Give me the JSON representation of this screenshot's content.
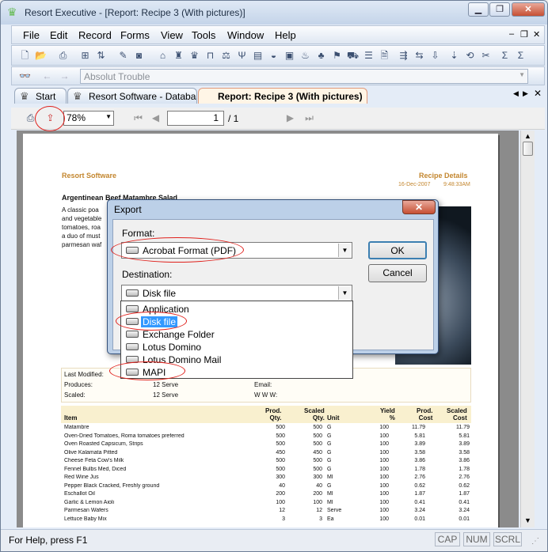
{
  "window": {
    "title": "Resort Executive - [Report: Recipe  3 (With pictures)]",
    "controls": {
      "minimize": "▁",
      "restore": "❐",
      "close": "✕"
    },
    "mdi_controls": {
      "minimize": "–",
      "restore": "❐",
      "close": "✕"
    }
  },
  "menu": [
    "File",
    "Edit",
    "Record",
    "Forms",
    "View",
    "Tools",
    "Window",
    "Help"
  ],
  "search": {
    "value": "Absolut Trouble"
  },
  "tabs": [
    {
      "label": "Start"
    },
    {
      "label": "Resort Software - Database"
    },
    {
      "label": "Report: Recipe  3 (With pictures)"
    }
  ],
  "viewer": {
    "zoom": "78%",
    "page": "1",
    "page_total": "/ 1"
  },
  "report": {
    "company": "Resort Software",
    "heading": "Recipe Details",
    "date": "16-Dec-2007",
    "time": "9:48:33AM",
    "recipe_name": "Argentinean Beef Matambre Salad",
    "description": [
      "A classic poa",
      "and vegetable",
      "tomatoes, roa",
      "a duo of must",
      "parmesan waf"
    ],
    "info": {
      "last_modified_label": "Last Modified:",
      "produces_label": "Produces:",
      "produces_value": "12 Serve",
      "scaled_label": "Scaled:",
      "scaled_value": "12 Serve",
      "email_label": "Email:",
      "www_label": "W W W:"
    },
    "table_headers": {
      "item": "Item",
      "prod_qty": "Prod.\nQty.",
      "scaled_qty": "Scaled\nQty.",
      "unit": "Unit",
      "yield": "Yield\n%",
      "prod_cost": "Prod.\nCost",
      "scaled_cost": "Scaled\nCost"
    },
    "rows": [
      {
        "item": "Matambre",
        "prod": "500",
        "scaled": "500",
        "unit": "G",
        "yield": "100",
        "pcost": "11.79",
        "scost": "11.79"
      },
      {
        "item": "Oven-Dried Tomatoes, Roma tomatoes preferred",
        "prod": "500",
        "scaled": "500",
        "unit": "G",
        "yield": "100",
        "pcost": "5.81",
        "scost": "5.81"
      },
      {
        "item": "Oven Roasted Capsicum, Strips",
        "prod": "500",
        "scaled": "500",
        "unit": "G",
        "yield": "100",
        "pcost": "3.89",
        "scost": "3.89"
      },
      {
        "item": "Olive Kalamata Pitted",
        "prod": "450",
        "scaled": "450",
        "unit": "G",
        "yield": "100",
        "pcost": "3.58",
        "scost": "3.58"
      },
      {
        "item": "Cheese Feta Cow's Milk",
        "prod": "500",
        "scaled": "500",
        "unit": "G",
        "yield": "100",
        "pcost": "3.86",
        "scost": "3.86"
      },
      {
        "item": "Fennel Bulbs Med, Diced",
        "prod": "500",
        "scaled": "500",
        "unit": "G",
        "yield": "100",
        "pcost": "1.78",
        "scost": "1.78"
      },
      {
        "item": "Red Wine Jus",
        "prod": "300",
        "scaled": "300",
        "unit": "Ml",
        "yield": "100",
        "pcost": "2.76",
        "scost": "2.76"
      },
      {
        "item": "Pepper Black Cracked, Freshly ground",
        "prod": "40",
        "scaled": "40",
        "unit": "G",
        "yield": "100",
        "pcost": "0.62",
        "scost": "0.62"
      },
      {
        "item": "Eschallot Oil",
        "prod": "200",
        "scaled": "200",
        "unit": "Ml",
        "yield": "100",
        "pcost": "1.87",
        "scost": "1.87"
      },
      {
        "item": "Garlic & Lemon Aioli",
        "prod": "100",
        "scaled": "100",
        "unit": "Ml",
        "yield": "100",
        "pcost": "0.41",
        "scost": "0.41"
      },
      {
        "item": "Parmesan Wafers",
        "prod": "12",
        "scaled": "12",
        "unit": "Serve",
        "yield": "100",
        "pcost": "3.24",
        "scost": "3.24"
      },
      {
        "item": "Lettuce Baby Mix",
        "prod": "3",
        "scaled": "3",
        "unit": "Ea",
        "yield": "100",
        "pcost": "0.01",
        "scost": "0.01"
      }
    ]
  },
  "dialog": {
    "title": "Export",
    "close": "✕",
    "format_label": "Format:",
    "format_value": "Acrobat Format (PDF)",
    "destination_label": "Destination:",
    "destination_value": "Disk file",
    "ok": "OK",
    "cancel": "Cancel",
    "options": [
      "Application",
      "Disk file",
      "Exchange Folder",
      "Lotus Domino",
      "Lotus Domino Mail",
      "MAPI"
    ]
  },
  "status": {
    "help": "For Help, press F1",
    "cap": "CAP",
    "num": "NUM",
    "scrl": "SCRL"
  },
  "colors": {
    "accent_orange": "#c3862e",
    "annotation_red": "#e0201b",
    "selection_blue": "#3399ff"
  }
}
